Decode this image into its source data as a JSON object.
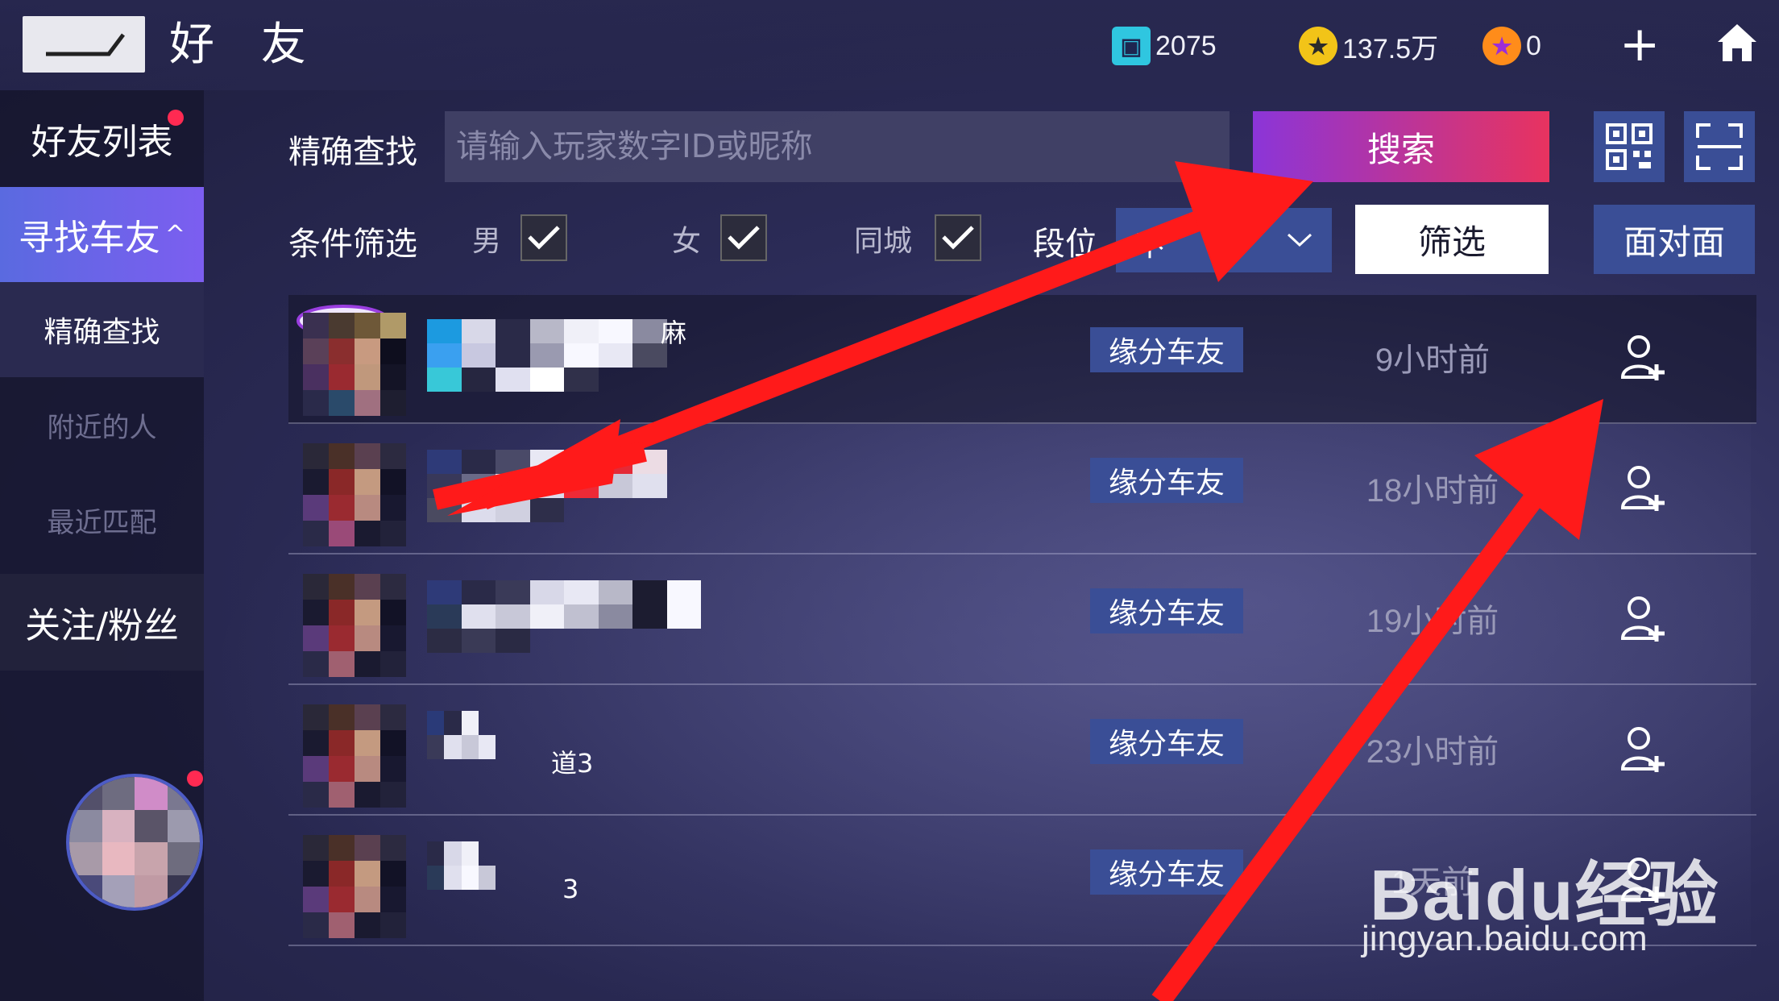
{
  "header": {
    "title": "好 友",
    "currencies": [
      {
        "icon": "ticket-icon",
        "value": "2075",
        "color": "#2fc6e0"
      },
      {
        "icon": "coin-icon",
        "value": "137.5万",
        "color": "#f2c418"
      },
      {
        "icon": "star-gem-icon",
        "value": "0",
        "color": "#ff8c1a"
      }
    ]
  },
  "sidebar": {
    "items": [
      {
        "label": "好友列表"
      },
      {
        "label": "寻找车友"
      },
      {
        "label": "精确查找"
      },
      {
        "label": "附近的人"
      },
      {
        "label": "最近匹配"
      },
      {
        "label": "关注/粉丝"
      }
    ]
  },
  "search": {
    "label": "精确查找",
    "placeholder": "请输入玩家数字ID或昵称",
    "button": "搜索"
  },
  "filters": {
    "label": "条件筛选",
    "male": "男",
    "female": "女",
    "same_city": "同城",
    "rank_label": "段位",
    "rank_value": "不",
    "filter_button": "筛选",
    "face_button": "面对面"
  },
  "friends": [
    {
      "name_tail": "麻",
      "tag": "缘分车友",
      "time": "9小时前"
    },
    {
      "name_tail": "",
      "tag": "缘分车友",
      "time": "18小时前"
    },
    {
      "name_tail": "",
      "tag": "缘分车友",
      "time": "19小时前"
    },
    {
      "name_tail": "道3",
      "tag": "缘分车友",
      "time": "23小时前"
    },
    {
      "name_tail": "3",
      "tag": "缘分车友",
      "time": "1天前"
    }
  ],
  "watermark": {
    "logo": "Baidu经验",
    "url": "jingyan.baidu.com"
  }
}
